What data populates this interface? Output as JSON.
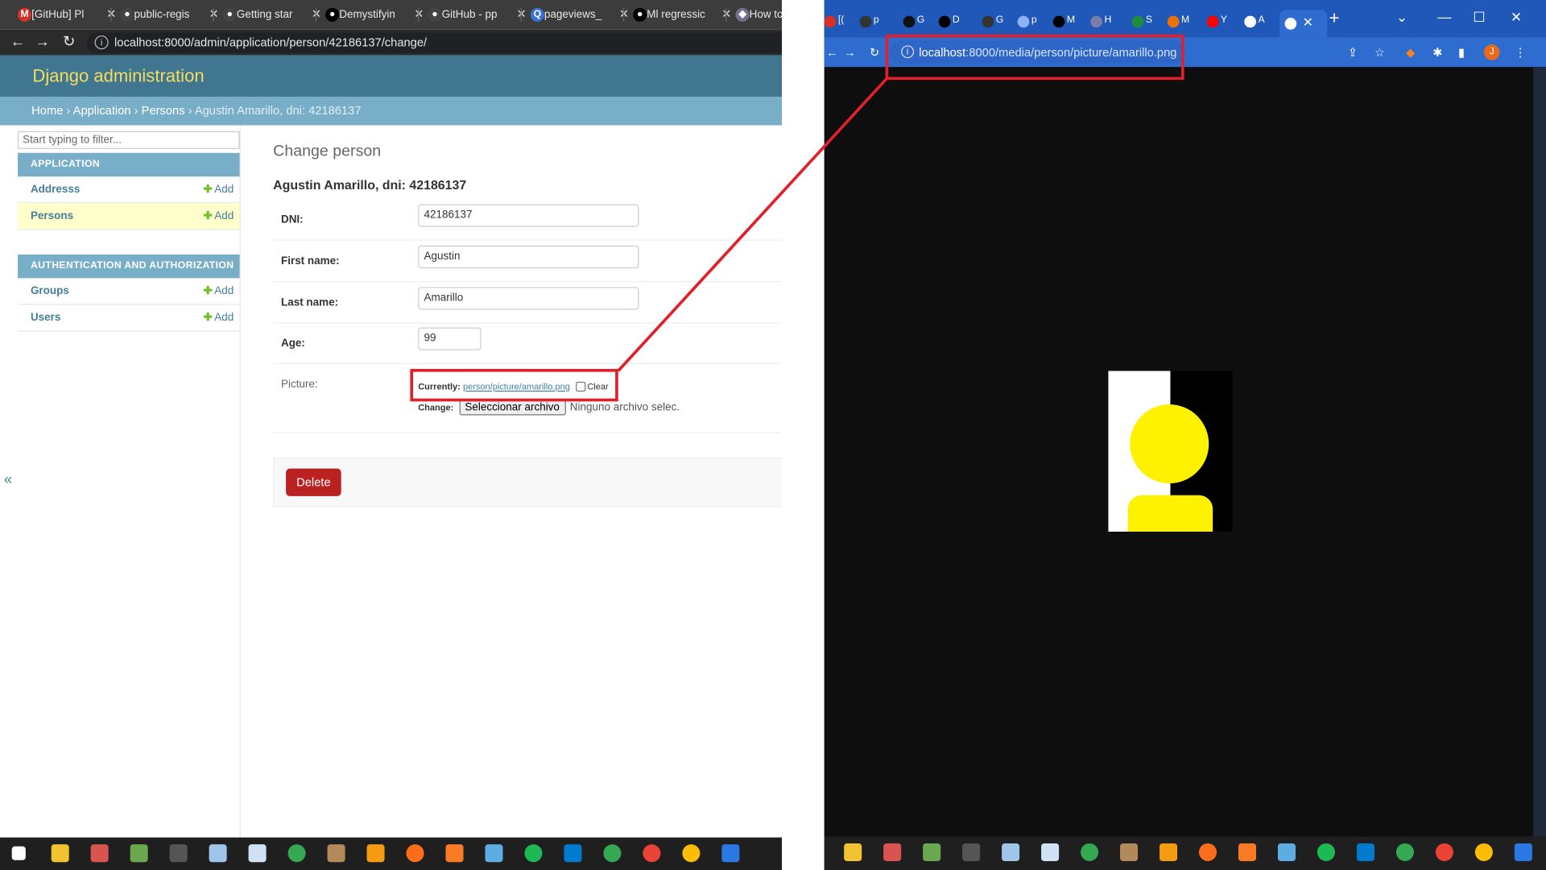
{
  "left_browser": {
    "tabs": [
      {
        "title": "[GitHub] Pl",
        "icon": "gmail-icon",
        "color": "#d93025"
      },
      {
        "title": "public-regis",
        "icon": "github-icon",
        "color": "#444444"
      },
      {
        "title": "Getting star",
        "icon": "github-icon",
        "color": "#444444"
      },
      {
        "title": "Demystifyin",
        "icon": "medium-icon",
        "color": "#000000"
      },
      {
        "title": "GitHub - pp",
        "icon": "github-icon",
        "color": "#444444"
      },
      {
        "title": "pageviews_",
        "icon": "search-icon",
        "color": "#3b6fd8"
      },
      {
        "title": "Ml regressic",
        "icon": "medium-icon",
        "color": "#000000"
      },
      {
        "title": "How to",
        "icon": "ethereum-icon",
        "color": "#6f6f8f"
      }
    ],
    "url": "localhost:8000/admin/application/person/42186137/change/"
  },
  "django": {
    "brand": "Django administration",
    "breadcrumbs": {
      "home": "Home",
      "application": "Application",
      "persons": "Persons",
      "current": "Agustin Amarillo, dni: 42186137",
      "sep": "›"
    },
    "filter_placeholder": "Start typing to filter...",
    "modules": [
      {
        "caption": "APPLICATION",
        "items": [
          {
            "name": "Addresss",
            "add": "Add",
            "active": false
          },
          {
            "name": "Persons",
            "add": "Add",
            "active": true
          }
        ]
      },
      {
        "caption": "AUTHENTICATION AND AUTHORIZATION",
        "items": [
          {
            "name": "Groups",
            "add": "Add",
            "active": false
          },
          {
            "name": "Users",
            "add": "Add",
            "active": false
          }
        ]
      }
    ],
    "collapse": "«",
    "page_title": "Change person",
    "object_title": "Agustin Amarillo, dni: 42186137",
    "fields": [
      {
        "label": "DNI:",
        "value": "42186137"
      },
      {
        "label": "First name:",
        "value": "Agustin"
      },
      {
        "label": "Last name:",
        "value": "Amarillo"
      },
      {
        "label": "Age:",
        "value": "99"
      }
    ],
    "picture": {
      "label": "Picture:",
      "currently": "Currently:",
      "link": "person/picture/amarillo.png",
      "clear": "Clear",
      "change": "Change:",
      "file_button": "Seleccionar archivo",
      "file_status": "Ninguno archivo selec."
    },
    "delete_label": "Delete"
  },
  "right_browser": {
    "url_host": "localhost",
    "url_path": ":8000/media/person/picture/amarillo.png",
    "avatar_letter": "J",
    "tab_letters": [
      "[(",
      "p",
      "G",
      "D",
      "G",
      "p",
      "M",
      "H",
      "S",
      "M",
      "Y",
      "A"
    ],
    "image": {
      "left_color": "#ffffff",
      "right_color": "#000000",
      "figure_color": "#fff200"
    }
  },
  "annotation_color": "#e0202a"
}
